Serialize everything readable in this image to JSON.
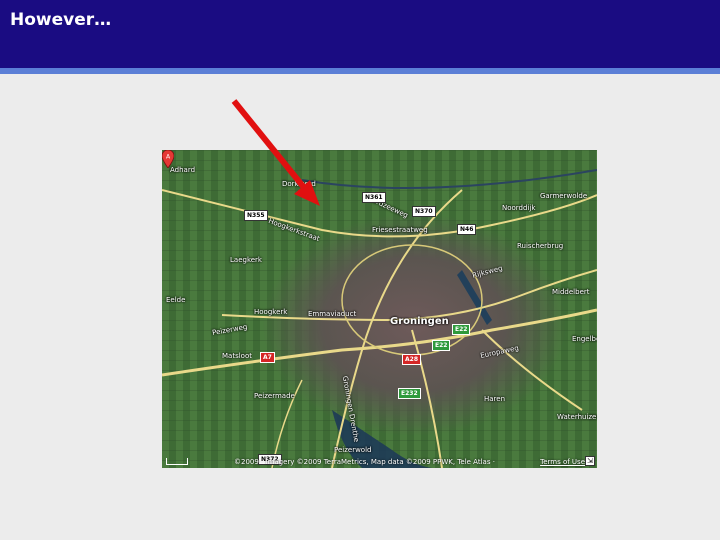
{
  "slide": {
    "title": "However…"
  },
  "map": {
    "place_labels": [
      {
        "name": "Adhard"
      },
      {
        "name": "Dorkwerd"
      },
      {
        "name": "Garmerwolde"
      },
      {
        "name": "Noorddijk"
      },
      {
        "name": "Ruischerbrug"
      },
      {
        "name": "Laegkerk"
      },
      {
        "name": "Hoogkerk"
      },
      {
        "name": "Middelbert"
      },
      {
        "name": "Engelbert"
      },
      {
        "name": "Matsloot"
      },
      {
        "name": "Peizermade"
      },
      {
        "name": "Eelde"
      },
      {
        "name": "Waterhuizen"
      },
      {
        "name": "Haren"
      },
      {
        "name": "Peizerwold"
      },
      {
        "name": "Groningen"
      }
    ],
    "road_shields": [
      {
        "label": "N361",
        "style": "white"
      },
      {
        "label": "N370",
        "style": "white"
      },
      {
        "label": "N355",
        "style": "white"
      },
      {
        "label": "N46",
        "style": "white"
      },
      {
        "label": "E22",
        "style": "green"
      },
      {
        "label": "E22",
        "style": "green"
      },
      {
        "label": "E232",
        "style": "green"
      },
      {
        "label": "A7",
        "style": "red"
      },
      {
        "label": "A28",
        "style": "red"
      },
      {
        "label": "N372",
        "style": "white"
      }
    ],
    "street_labels": [
      {
        "name": "Noordzeeweg"
      },
      {
        "name": "Hoogkerkstraat"
      },
      {
        "name": "Friesestraatweg"
      },
      {
        "name": "Peizerweg"
      },
      {
        "name": "Emmaviaduct"
      },
      {
        "name": "Groningen Drenthe"
      },
      {
        "name": "Europaweg"
      },
      {
        "name": "Rijksweg"
      }
    ],
    "marker_label": "A",
    "city_name": "Groningen",
    "copyright": "©2009 · Imagery ©2009 TerraMetrics, Map data ©2009 PPWK, Tele Atlas ·",
    "terms_link": "Terms of Use"
  },
  "colors": {
    "title_bar": "#1a0c82",
    "title_accent": "#5b7fd6",
    "arrow": "#e11010",
    "slide_bg": "#ececec"
  }
}
